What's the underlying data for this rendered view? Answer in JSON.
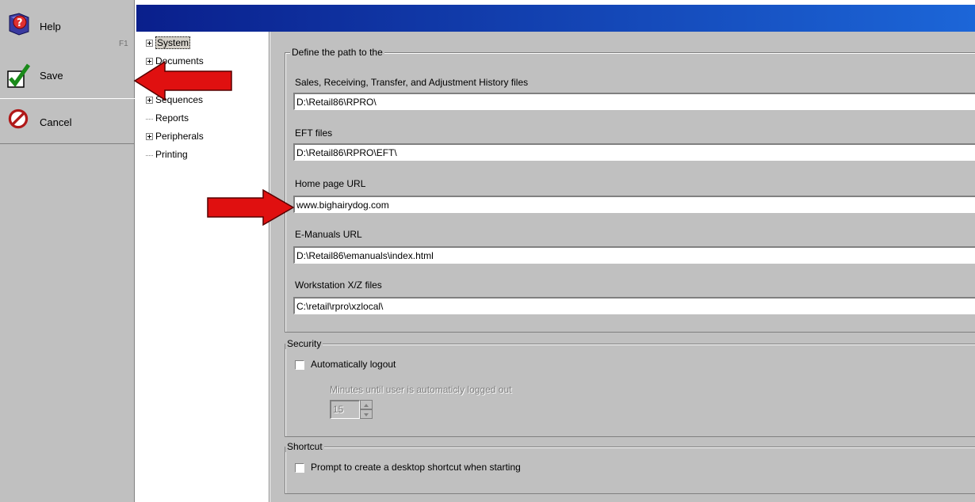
{
  "toolbar": {
    "help_label": "Help",
    "help_hotkey": "F1",
    "save_label": "Save",
    "cancel_label": "Cancel"
  },
  "tree": {
    "items": [
      {
        "label": "System",
        "expandable": true
      },
      {
        "label": "Documents",
        "expandable": true
      },
      {
        "label": "Sequences",
        "expandable": true
      },
      {
        "label": "Reports",
        "expandable": false
      },
      {
        "label": "Peripherals",
        "expandable": true
      },
      {
        "label": "Printing",
        "expandable": false
      }
    ]
  },
  "paths": {
    "legend": "Define the path to the",
    "history_label": "Sales, Receiving, Transfer, and Adjustment History files",
    "history_value": "D:\\Retail86\\RPRO\\",
    "eft_label": "EFT files",
    "eft_value": "D:\\Retail86\\RPRO\\EFT\\",
    "homepage_label": "Home page URL",
    "homepage_value": "www.bighairydog.com",
    "emanuals_label": "E-Manuals URL",
    "emanuals_value": "D:\\Retail86\\emanuals\\index.html",
    "workstation_label": "Workstation X/Z files",
    "workstation_value": "C:\\retail\\rpro\\xzlocal\\"
  },
  "security": {
    "legend": "Security",
    "auto_logout_label": "Automatically logout",
    "auto_logout_checked": false,
    "minutes_label": "Minutes until user is automaticly logged out",
    "minutes_value": "15"
  },
  "shortcut": {
    "legend": "Shortcut",
    "prompt_label": "Prompt to create a desktop shortcut when starting",
    "prompt_checked": false
  },
  "colors": {
    "annotation_arrow": "#e01010",
    "titlebar_start": "#0a1f8c",
    "titlebar_end": "#1c66d8"
  }
}
